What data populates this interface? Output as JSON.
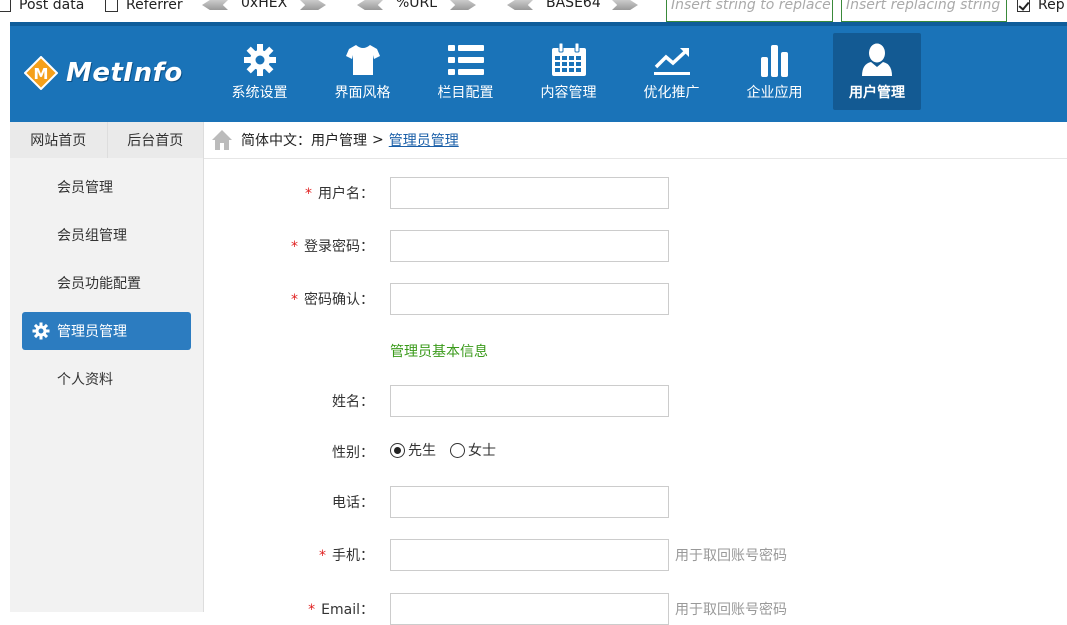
{
  "hackbar": {
    "post_data_label": "Post data",
    "referrer_label": "Referrer",
    "hex_label": "0xHEX",
    "url_label": "%URL",
    "base64_label": "BASE64",
    "replace_placeholder": "Insert string to replace",
    "replacing_placeholder": "Insert replacing string",
    "rep_label": "Rep"
  },
  "header": {
    "logo_text": "MetInfo",
    "nav": [
      {
        "label": "系统设置",
        "icon": "gear-icon"
      },
      {
        "label": "界面风格",
        "icon": "tshirt-icon"
      },
      {
        "label": "栏目配置",
        "icon": "list-icon"
      },
      {
        "label": "内容管理",
        "icon": "calendar-icon"
      },
      {
        "label": "优化推广",
        "icon": "trend-chart-icon"
      },
      {
        "label": "企业应用",
        "icon": "bar-chart-icon"
      },
      {
        "label": "用户管理",
        "icon": "user-icon"
      }
    ]
  },
  "sidebar": {
    "tabs": [
      "网站首页",
      "后台首页"
    ],
    "items": [
      "会员管理",
      "会员组管理",
      "会员功能配置",
      "管理员管理",
      "个人资料"
    ]
  },
  "breadcrumb": {
    "prefix": "简体中文：用户管理",
    "sep": ">",
    "current": "管理员管理"
  },
  "form": {
    "username_label": "用户名：",
    "password_label": "登录密码：",
    "confirm_label": "密码确认：",
    "section_title": "管理员基本信息",
    "name_label": "姓名：",
    "gender_label": "性别：",
    "gender_male": "先生",
    "gender_female": "女士",
    "phone_label": "电话：",
    "mobile_label": "手机：",
    "mobile_hint": "用于取回账号密码",
    "email_label": "Email：",
    "email_hint": "用于取回账号密码",
    "required_mark": "*"
  },
  "colors": {
    "header_blue": "#1a73b8",
    "active_nav": "#135a93",
    "sidebar_active": "#2c7cc0",
    "section_green": "#3a9a1a",
    "required_red": "#e02020"
  }
}
